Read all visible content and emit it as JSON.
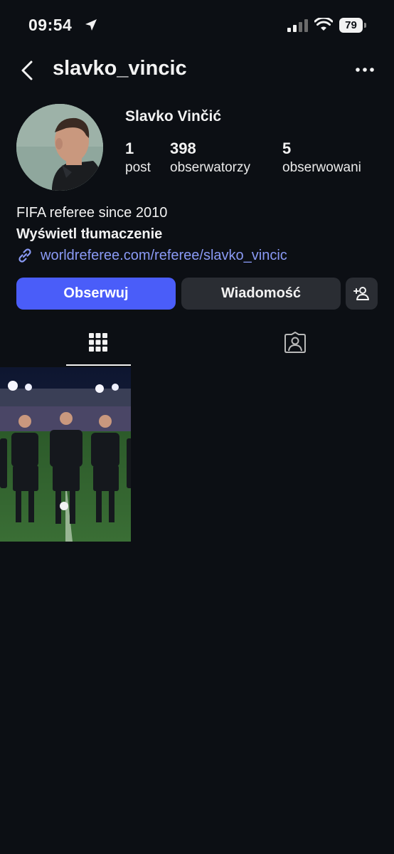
{
  "status_bar": {
    "time": "09:54",
    "battery": "79",
    "location_icon": "location-arrow-icon",
    "signal_icon": "cellular-signal-icon",
    "wifi_icon": "wifi-icon"
  },
  "header": {
    "username": "slavko_vincic",
    "back_icon": "chevron-left-icon",
    "more_icon": "more-horizontal-icon"
  },
  "profile": {
    "full_name": "Slavko Vinčić",
    "stats": [
      {
        "value": "1",
        "label": "post"
      },
      {
        "value": "398",
        "label": "obserwatorzy"
      },
      {
        "value": "5",
        "label": "obserwowani"
      }
    ],
    "bio": "FIFA referee since 2010",
    "translate_label": "Wyświetl tłumaczenie",
    "link": "worldreferee.com/referee/slavko_vincic",
    "link_icon": "link-icon"
  },
  "actions": {
    "follow_label": "Obserwuj",
    "message_label": "Wiadomość",
    "add_user_icon": "add-person-icon"
  },
  "tabs": {
    "grid_icon": "grid-icon",
    "tagged_icon": "tagged-person-icon",
    "active": "grid"
  },
  "colors": {
    "background": "#0c0f14",
    "accent": "#4a5df9",
    "link": "#8a9af5",
    "button_secondary": "#2a2d33"
  },
  "posts_count": 1
}
